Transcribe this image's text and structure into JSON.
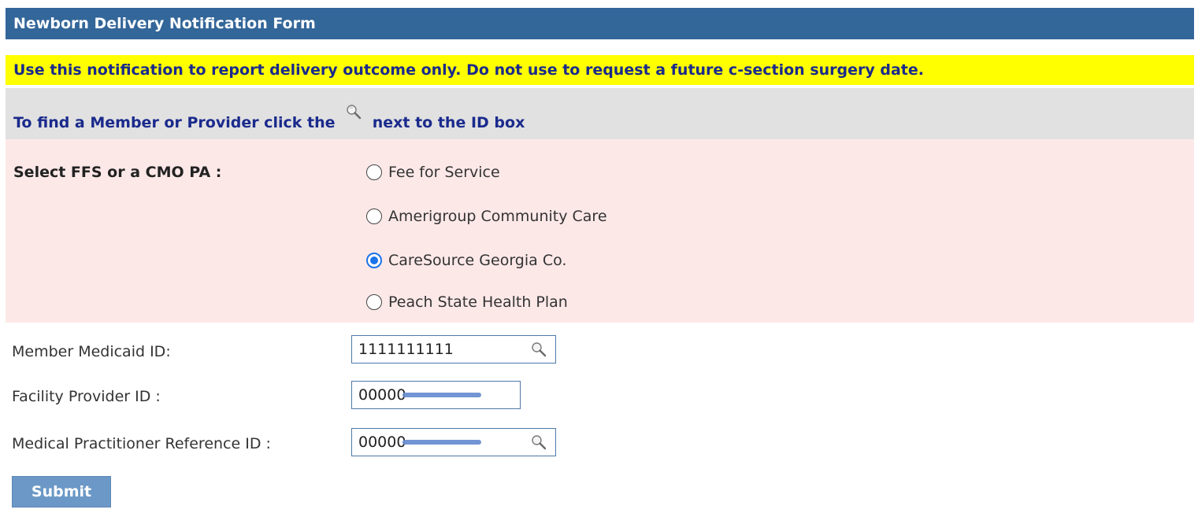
{
  "header": {
    "title": "Newborn Delivery Notification Form"
  },
  "notice": {
    "text": "Use this notification to report delivery outcome only. Do not use to request a future c-section surgery date."
  },
  "hint": {
    "before": "To find a Member or Provider click the",
    "after": "next to the ID box"
  },
  "plan_selection": {
    "label": "Select FFS or a CMO PA :",
    "options": [
      {
        "label": "Fee for Service",
        "selected": false
      },
      {
        "label": "Amerigroup Community Care",
        "selected": false
      },
      {
        "label": "CareSource Georgia Co.",
        "selected": true
      },
      {
        "label": "Peach State Health Plan",
        "selected": false
      }
    ]
  },
  "fields": {
    "member_medicaid_id": {
      "label": "Member Medicaid ID:",
      "value": "1111111111"
    },
    "facility_provider_id": {
      "label": "Facility Provider ID :",
      "value": "00000"
    },
    "practitioner_reference_id": {
      "label": "Medical Practitioner Reference ID :",
      "value": "00000"
    }
  },
  "submit": {
    "label": "Submit"
  },
  "colors": {
    "header_bg": "#336699",
    "notice_bg": "#ffff00",
    "hint_bg": "#e1e1e1",
    "section_bg": "#fde8e8",
    "radio_selected": "#1a73e8",
    "submit_bg": "#6b98c6"
  },
  "icons": {
    "lookup": "magnifier-icon"
  }
}
